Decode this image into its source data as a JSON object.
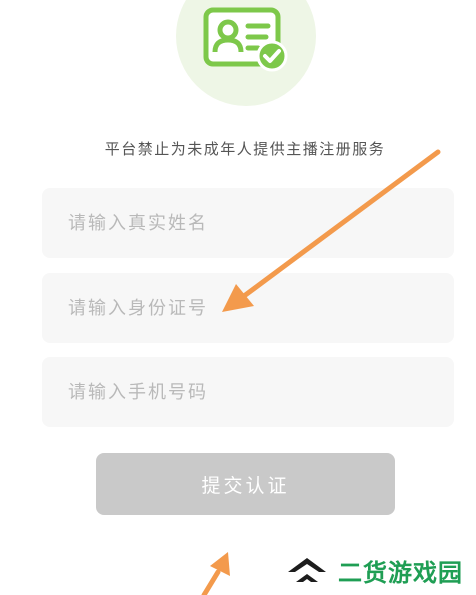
{
  "header": {
    "icon": "id-card-verified-icon",
    "accent_color": "#7dc84a",
    "notice": "平台禁止为未成年人提供主播注册服务"
  },
  "form": {
    "name_placeholder": "请输入真实姓名",
    "id_placeholder": "请输入身份证号",
    "phone_placeholder": "请输入手机号码",
    "submit_label": "提交认证",
    "submit_color": "#c9c9c9"
  },
  "annotation": {
    "arrow_color": "#f39a4c",
    "arrows": [
      "arrow-to-id-field",
      "arrow-partial-bottom"
    ]
  },
  "watermark": {
    "text": "二货游戏园",
    "color": "#1f9e54"
  }
}
